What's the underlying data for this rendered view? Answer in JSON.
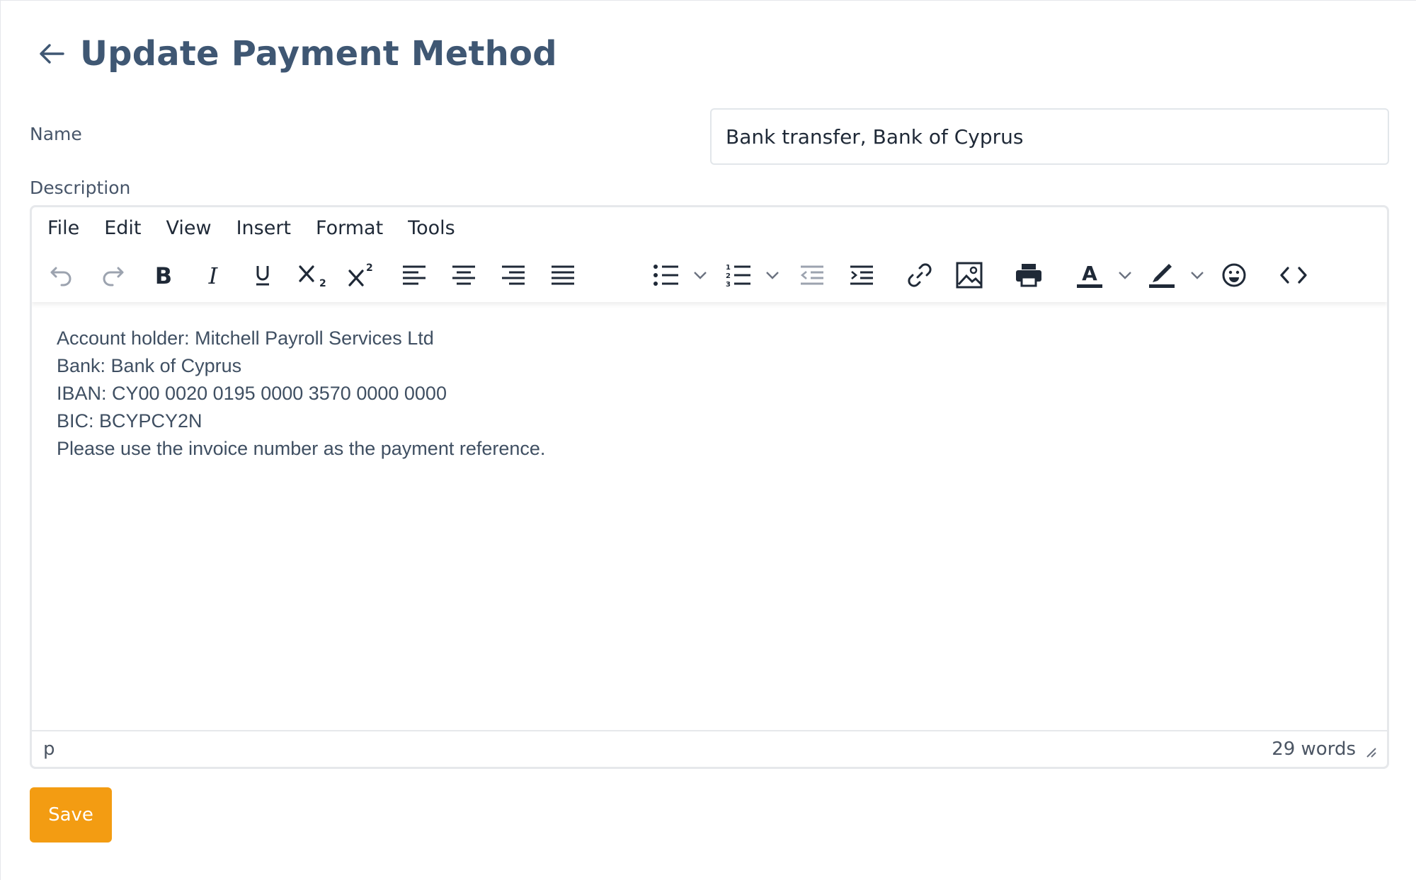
{
  "header": {
    "title": "Update Payment Method",
    "back_icon": "arrow-left-icon"
  },
  "form": {
    "name_label": "Name",
    "name_value": "Bank transfer, Bank of Cyprus",
    "description_label": "Description"
  },
  "editor": {
    "menu": [
      "File",
      "Edit",
      "View",
      "Insert",
      "Format",
      "Tools"
    ],
    "toolbar_icons": [
      "undo-icon",
      "redo-icon",
      "bold-icon",
      "italic-icon",
      "underline-icon",
      "subscript-icon",
      "superscript-icon",
      "align-left-icon",
      "align-center-icon",
      "align-right-icon",
      "align-justify-icon",
      "bullet-list-icon",
      "numbered-list-icon",
      "outdent-icon",
      "indent-icon",
      "link-icon",
      "image-icon",
      "print-icon",
      "text-color-icon",
      "highlight-color-icon",
      "emoji-icon",
      "code-icon"
    ],
    "content": [
      "Account holder: Mitchell Payroll Services Ltd",
      "Bank: Bank of Cyprus",
      "IBAN: CY00 0020 0195 0000 3570 0000 0000",
      "BIC: BCYPCY2N",
      "Please use the invoice number as the payment reference."
    ],
    "status_path": "p",
    "word_count": "29 words"
  },
  "actions": {
    "save_label": "Save"
  },
  "colors": {
    "accent": "#f39c12",
    "title": "#3f5773",
    "text": "#3f4f62"
  }
}
